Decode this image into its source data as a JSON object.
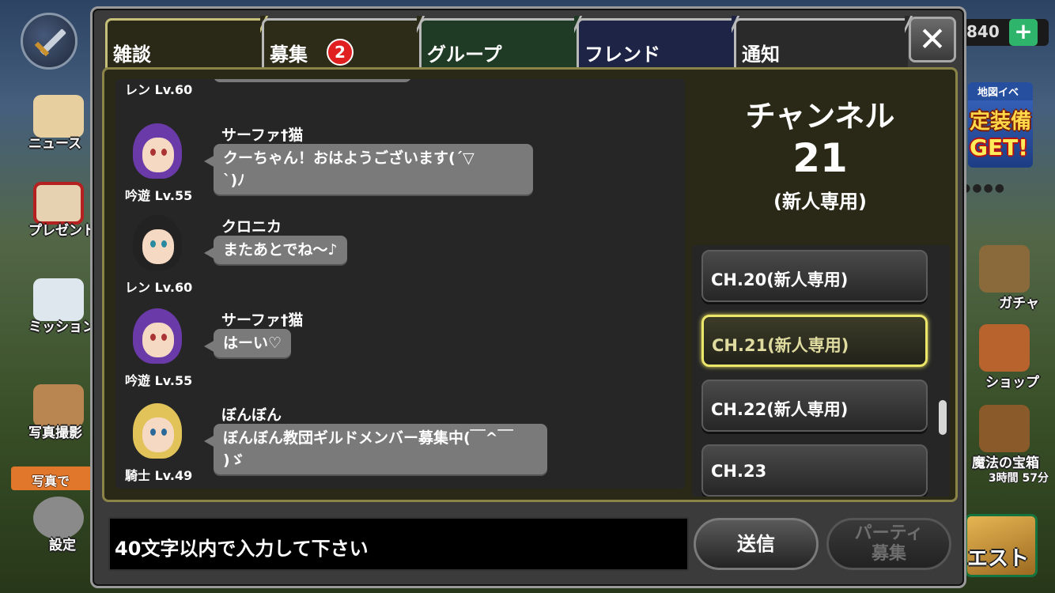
{
  "side_left": {
    "news_label": "ニュース",
    "present_label": "プレゼント",
    "mission_label": "ミッション",
    "photo_label": "写真撮影",
    "photo_strip": "写真で",
    "settings_label": "設定"
  },
  "side_right": {
    "coins": "840",
    "plus": "+",
    "event_top": "地図イベ",
    "event_mid": "定装備",
    "event_get": "GET!",
    "gacha_label": "ガチャ",
    "shop_label": "ショップ",
    "chest_label": "魔法の宝箱",
    "chest_timer": "3時間 57分",
    "quest_label": "エスト"
  },
  "tabs": [
    {
      "label": "雑談",
      "active": true
    },
    {
      "label": "募集",
      "badge": "2"
    },
    {
      "label": "グループ"
    },
    {
      "label": "フレンド"
    },
    {
      "label": "通知"
    }
  ],
  "close": "✕",
  "chat": {
    "top_stub_level": "レン Lv.60",
    "messages": [
      {
        "name": "サーファ†猫",
        "level": "吟遊 Lv.55",
        "text1": "クーちゃん！おはようございます(´▽",
        "text2": "`)ﾉ"
      },
      {
        "name": "クロニカ",
        "level": "レン Lv.60",
        "text1": "またあとでね〜♪"
      },
      {
        "name": "サーファ†猫",
        "level": "吟遊 Lv.55",
        "text1": "はーい♡"
      },
      {
        "name": "ぼんぼん",
        "level": "騎士 Lv.49",
        "text1": "ぼんぼん教団ギルドメンバー募集中(￣^￣",
        "text2": ")ゞ"
      }
    ]
  },
  "channel": {
    "title": "チャンネル",
    "number": "21",
    "note": "(新人専用)",
    "list": [
      "CH.20(新人専用)",
      "CH.21(新人専用)",
      "CH.22(新人専用)",
      "CH.23"
    ],
    "selected_index": 1
  },
  "input": {
    "placeholder": "40文字以内で入力して下さい"
  },
  "send_label": "送信",
  "party_line1": "パーティ",
  "party_line2": "募集",
  "colors": {
    "accent_yellow": "#ece66a",
    "badge_red": "#e02020"
  }
}
